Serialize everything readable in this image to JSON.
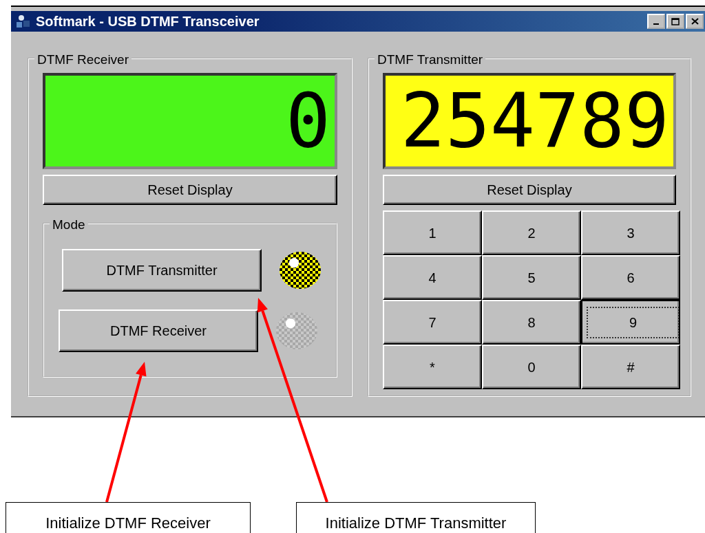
{
  "window": {
    "title": "Softmark - USB DTMF Transceiver"
  },
  "receiver": {
    "legend": "DTMF Receiver",
    "display": "0",
    "reset_button": "Reset Display"
  },
  "mode": {
    "legend": "Mode",
    "options": [
      {
        "label": "DTMF Transmitter",
        "selected": true
      },
      {
        "label": "DTMF Receiver",
        "selected": false
      }
    ]
  },
  "transmitter": {
    "legend": "DTMF Transmitter",
    "display": "254789",
    "reset_button": "Reset Display",
    "keypad": [
      {
        "label": "1",
        "focused": false
      },
      {
        "label": "2",
        "focused": false
      },
      {
        "label": "3",
        "focused": false
      },
      {
        "label": "4",
        "focused": false
      },
      {
        "label": "5",
        "focused": false
      },
      {
        "label": "6",
        "focused": false
      },
      {
        "label": "7",
        "focused": false
      },
      {
        "label": "8",
        "focused": false
      },
      {
        "label": "9",
        "focused": true
      },
      {
        "label": "*",
        "focused": false
      },
      {
        "label": "0",
        "focused": false
      },
      {
        "label": "#",
        "focused": false
      }
    ]
  },
  "callouts": [
    {
      "text": "Initialize DTMF Receiver"
    },
    {
      "text": "Initialize DTMF Transmitter"
    }
  ]
}
